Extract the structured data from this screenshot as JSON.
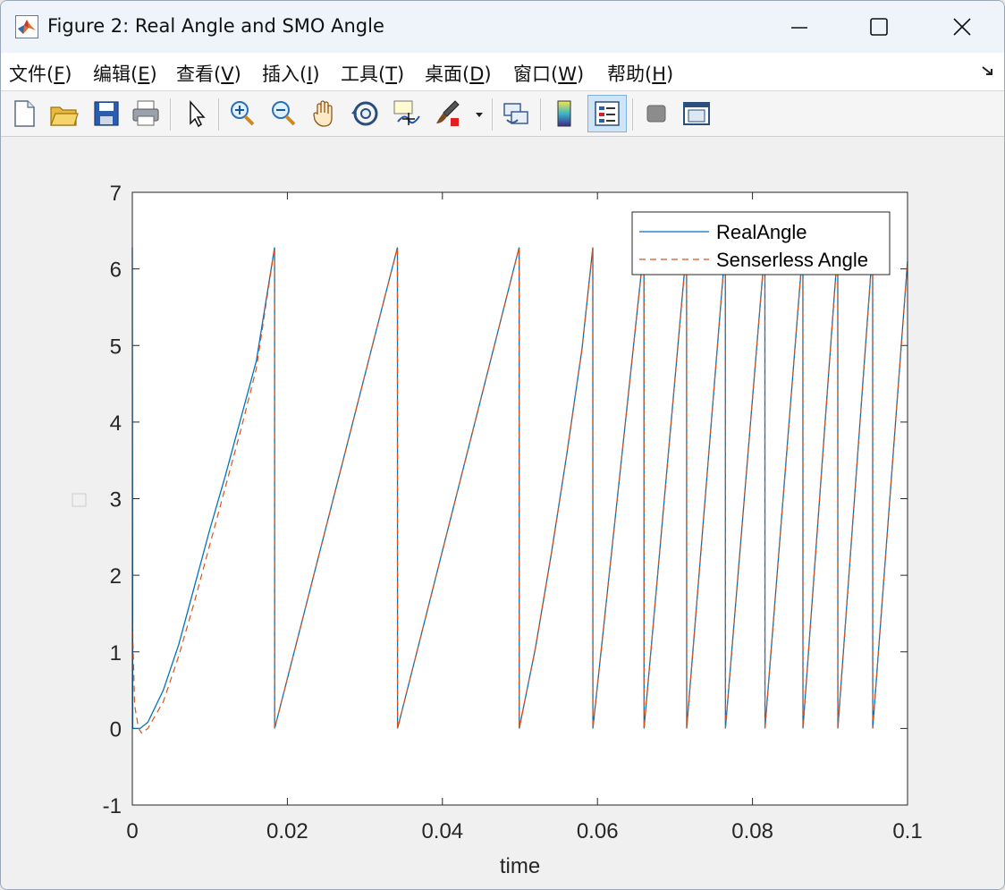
{
  "window": {
    "title": "Figure 2: Real Angle and SMO Angle"
  },
  "menu": [
    {
      "name": "文件",
      "key": "F"
    },
    {
      "name": "编辑",
      "key": "E"
    },
    {
      "name": "查看",
      "key": "V"
    },
    {
      "name": "插入",
      "key": "I"
    },
    {
      "name": "工具",
      "key": "T"
    },
    {
      "name": "桌面",
      "key": "D"
    },
    {
      "name": "窗口",
      "key": "W"
    },
    {
      "name": "帮助",
      "key": "H"
    }
  ],
  "toolbar": {
    "icons": [
      "new-figure-icon",
      "open-file-icon",
      "save-icon",
      "print-icon",
      "pointer-icon",
      "zoom-in-icon",
      "zoom-out-icon",
      "pan-hand-icon",
      "rotate-3d-icon",
      "data-cursor-icon",
      "brush-icon",
      "brush-dropdown-icon",
      "link-plot-icon",
      "colorbar-icon",
      "legend-icon",
      "hide-tools-icon",
      "dock-icon"
    ],
    "active": "legend-icon"
  },
  "colors": {
    "real": "#0072BD",
    "smo": "#D95319"
  },
  "chart_data": {
    "type": "line",
    "xlabel": "time",
    "ylabel": "",
    "xlim": [
      0,
      0.1
    ],
    "ylim": [
      -1,
      7
    ],
    "xticks": [
      "0",
      "0.02",
      "0.04",
      "0.06",
      "0.08",
      "0.1"
    ],
    "yticks": [
      "-1",
      "0",
      "1",
      "2",
      "3",
      "4",
      "5",
      "6",
      "7"
    ],
    "legend_position": "top-right",
    "series": [
      {
        "name": "RealAngle",
        "style": "solid",
        "points": [
          [
            0,
            6.28
          ],
          [
            5e-05,
            0.0
          ],
          [
            0.001,
            0.0
          ],
          [
            0.002,
            0.08
          ],
          [
            0.004,
            0.5
          ],
          [
            0.006,
            1.1
          ],
          [
            0.008,
            1.85
          ],
          [
            0.01,
            2.6
          ],
          [
            0.012,
            3.3
          ],
          [
            0.014,
            4.05
          ],
          [
            0.016,
            4.8
          ],
          [
            0.01835,
            6.28
          ],
          [
            0.01836,
            0.0
          ],
          [
            0.0342,
            6.28
          ],
          [
            0.03421,
            0.0
          ],
          [
            0.0499,
            6.28
          ],
          [
            0.04991,
            0.0
          ],
          [
            0.052,
            1.05
          ],
          [
            0.054,
            2.25
          ],
          [
            0.056,
            3.55
          ],
          [
            0.058,
            4.95
          ],
          [
            0.0594,
            6.28
          ],
          [
            0.05941,
            0.0
          ],
          [
            0.066,
            6.28
          ],
          [
            0.06601,
            0.0
          ],
          [
            0.0715,
            6.28
          ],
          [
            0.07151,
            0.0
          ],
          [
            0.0765,
            6.28
          ],
          [
            0.07651,
            0.0
          ],
          [
            0.0816,
            6.28
          ],
          [
            0.08161,
            0.0
          ],
          [
            0.0865,
            6.28
          ],
          [
            0.08651,
            0.0
          ],
          [
            0.091,
            6.28
          ],
          [
            0.09101,
            0.0
          ],
          [
            0.0955,
            6.28
          ],
          [
            0.09551,
            0.0
          ],
          [
            0.1,
            6.1
          ]
        ]
      },
      {
        "name": "Senserless Angle",
        "style": "dashed",
        "points": [
          [
            0,
            1.4
          ],
          [
            0.0003,
            0.3
          ],
          [
            0.0008,
            0.0
          ],
          [
            0.0012,
            -0.06
          ],
          [
            0.002,
            0.0
          ],
          [
            0.004,
            0.35
          ],
          [
            0.006,
            0.95
          ],
          [
            0.008,
            1.65
          ],
          [
            0.01,
            2.4
          ],
          [
            0.012,
            3.15
          ],
          [
            0.014,
            3.9
          ],
          [
            0.016,
            4.7
          ],
          [
            0.01835,
            6.28
          ],
          [
            0.01836,
            0.0
          ],
          [
            0.0342,
            6.28
          ],
          [
            0.03421,
            0.0
          ],
          [
            0.0499,
            6.28
          ],
          [
            0.04991,
            0.0
          ],
          [
            0.052,
            1.05
          ],
          [
            0.054,
            2.25
          ],
          [
            0.056,
            3.55
          ],
          [
            0.058,
            4.95
          ],
          [
            0.0594,
            6.28
          ],
          [
            0.05941,
            0.0
          ],
          [
            0.066,
            6.28
          ],
          [
            0.06601,
            0.0
          ],
          [
            0.0715,
            6.28
          ],
          [
            0.07151,
            0.0
          ],
          [
            0.0765,
            6.28
          ],
          [
            0.07651,
            0.0
          ],
          [
            0.0816,
            6.28
          ],
          [
            0.08161,
            0.0
          ],
          [
            0.0865,
            6.28
          ],
          [
            0.08651,
            0.0
          ],
          [
            0.091,
            6.28
          ],
          [
            0.09101,
            0.0
          ],
          [
            0.0955,
            6.28
          ],
          [
            0.09551,
            0.0
          ],
          [
            0.1,
            6.1
          ]
        ]
      }
    ]
  }
}
